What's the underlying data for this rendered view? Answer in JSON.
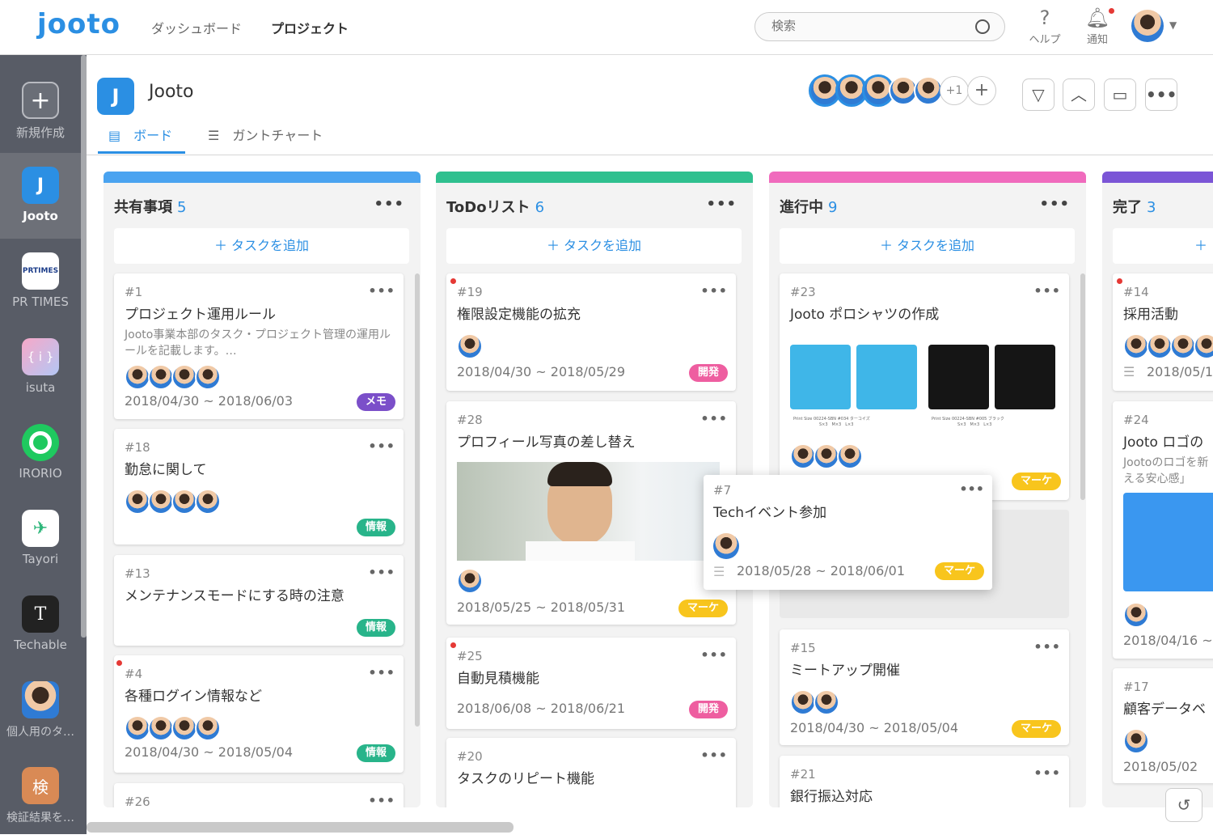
{
  "topbar": {
    "logo": "jooto",
    "nav": [
      "ダッシュボード",
      "プロジェクト"
    ],
    "search_placeholder": "検索",
    "help": "ヘルプ",
    "notify": "通知"
  },
  "sidebar": {
    "items": [
      {
        "label": "新規作成",
        "glyph": "+"
      },
      {
        "label": "Jooto",
        "glyph": "J"
      },
      {
        "label": "PR TIMES",
        "glyph": "PRTIMES"
      },
      {
        "label": "isuta",
        "glyph": "{ i }"
      },
      {
        "label": "IRORIO",
        "glyph": "○"
      },
      {
        "label": "Tayori",
        "glyph": "✈"
      },
      {
        "label": "Techable",
        "glyph": "T"
      },
      {
        "label": "個人用のタ…",
        "glyph": ""
      },
      {
        "label": "検証結果を…",
        "glyph": "検"
      }
    ]
  },
  "project": {
    "title": "Jooto",
    "icon": "J",
    "tabs": [
      "ボード",
      "ガントチャート"
    ],
    "members_more": "+1"
  },
  "columns": [
    {
      "name": "共有事項",
      "count": "5",
      "color": "#4aa3f0",
      "add": "＋ タスクを追加",
      "cards": [
        {
          "num": "#1",
          "title": "プロジェクト運用ルール",
          "desc": "Jooto事業本部のタスク・プロジェクト管理の運用ルールを記載します。…",
          "date": "2018/04/30 ~ 2018/06/03",
          "tag": "メモ"
        },
        {
          "num": "#18",
          "title": "勤怠に関して",
          "date": "",
          "tag": "情報"
        },
        {
          "num": "#13",
          "title": "メンテナンスモードにする時の注意",
          "date": "",
          "tag": "情報"
        },
        {
          "num": "#4",
          "title": "各種ログイン情報など",
          "date": "2018/04/30 ~ 2018/05/04",
          "tag": "情報"
        },
        {
          "num": "#26",
          "title": ""
        }
      ]
    },
    {
      "name": "ToDoリスト",
      "count": "6",
      "color": "#2fc08f",
      "add": "＋ タスクを追加",
      "cards": [
        {
          "num": "#19",
          "title": "権限設定機能の拡充",
          "date": "2018/04/30 ~ 2018/05/29",
          "tag": "開発"
        },
        {
          "num": "#28",
          "title": "プロフィール写真の差し替え",
          "date": "2018/05/25 ~ 2018/05/31",
          "tag": "マーケ"
        },
        {
          "num": "#25",
          "title": "自動見積機能",
          "date": "2018/06/08 ~ 2018/06/21",
          "tag": "開発"
        },
        {
          "num": "#20",
          "title": "タスクのリピート機能"
        }
      ]
    },
    {
      "name": "進行中",
      "count": "9",
      "color": "#f06bbd",
      "add": "＋ タスクを追加",
      "cards": [
        {
          "num": "#23",
          "title": "Jooto ポロシャツの作成",
          "tag": "マーケ"
        },
        {
          "num": "#15",
          "title": "ミートアップ開催",
          "date": "2018/04/30 ~ 2018/05/04",
          "tag": "マーケ"
        },
        {
          "num": "#21",
          "title": "銀行振込対応"
        }
      ]
    },
    {
      "name": "完了",
      "count": "3",
      "color": "#7b55d6",
      "cards": [
        {
          "num": "#14",
          "title": "採用活動",
          "date": "2018/05/1"
        },
        {
          "num": "#24",
          "title": "Jooto ロゴの",
          "desc": "Jootoのロゴを新える安心感」",
          "date": "2018/04/16 ~"
        },
        {
          "num": "#17",
          "title": "顧客データベ",
          "date": "2018/05/02"
        }
      ]
    }
  ],
  "floating_card": {
    "num": "#7",
    "title": "Techイベント参加",
    "date": "2018/05/28 ~ 2018/06/01",
    "tag": "マーケ"
  },
  "shirt_caption": "Print Size 00224-SBN #034 ターコイズ",
  "shirt_caption2": "Print Size 00224-SBN #005 ブラック",
  "shirt_sizes": "S×3　M×3　L×3"
}
